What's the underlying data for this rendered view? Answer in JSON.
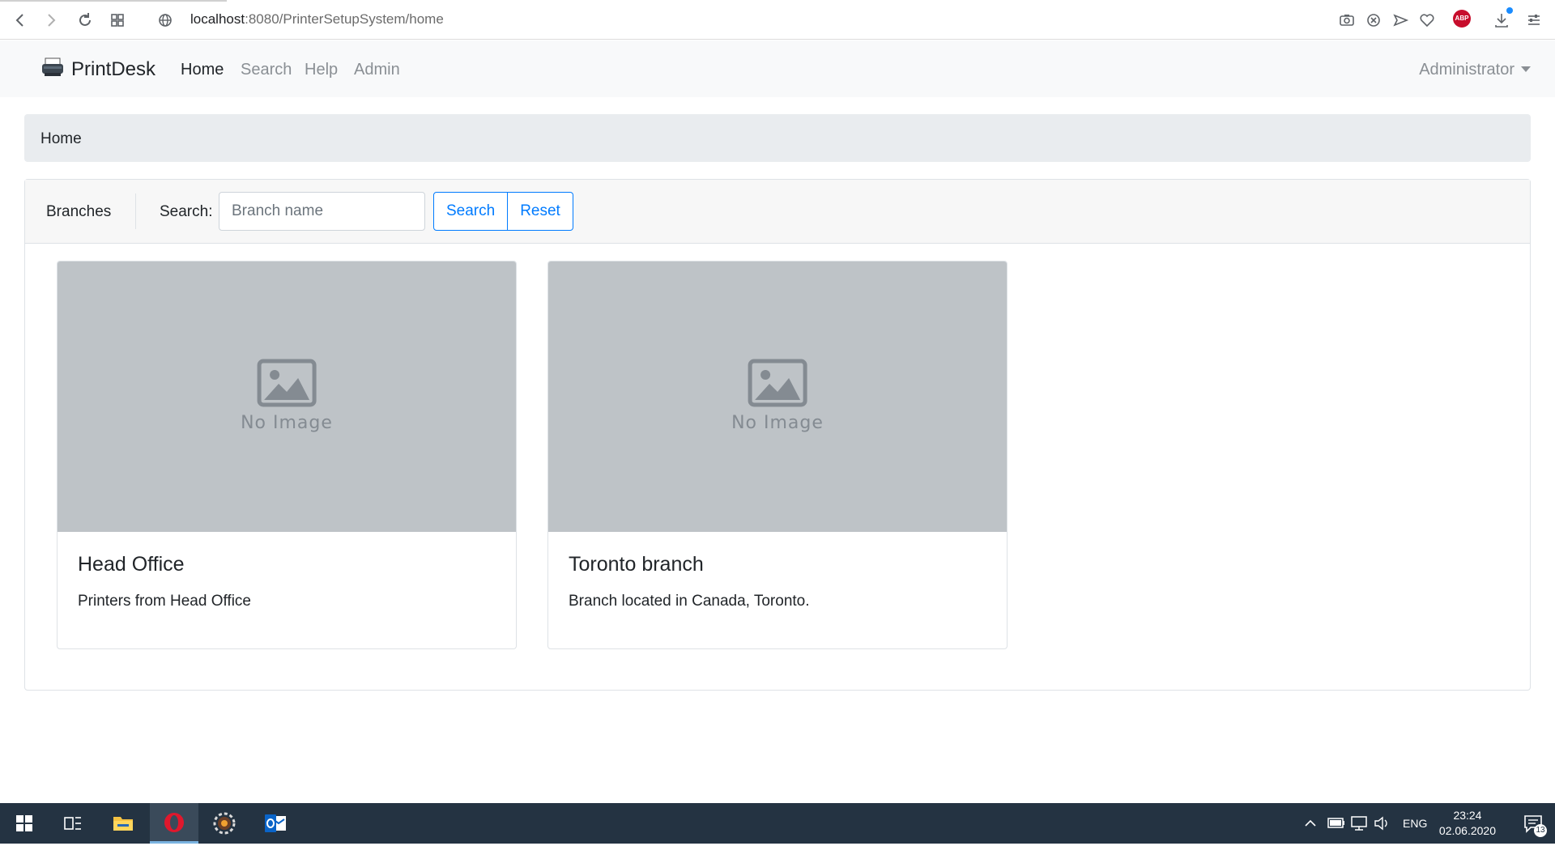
{
  "browser": {
    "url_host": "localhost",
    "url_path": ":8080/PrinterSetupSystem/home",
    "abp_label": "ABP"
  },
  "navbar": {
    "brand": "PrintDesk",
    "links": [
      {
        "label": "Home",
        "active": true
      },
      {
        "label": "Search",
        "active": false
      },
      {
        "label": "Help",
        "active": false
      },
      {
        "label": "Admin",
        "active": false
      }
    ],
    "user_menu": "Administrator"
  },
  "breadcrumb": {
    "current": "Home"
  },
  "branches_panel": {
    "title": "Branches",
    "search_label": "Search:",
    "search_placeholder": "Branch name",
    "search_value": "",
    "search_button": "Search",
    "reset_button": "Reset"
  },
  "branches": [
    {
      "image_text": "No Image",
      "title": "Head Office",
      "description": "Printers from Head Office"
    },
    {
      "image_text": "No Image",
      "title": "Toronto branch",
      "description": "Branch located in Canada, Toronto."
    }
  ],
  "taskbar": {
    "language": "ENG",
    "time": "23:24",
    "date": "02.06.2020",
    "notification_count": "13"
  },
  "colors": {
    "primary": "#007bff",
    "navbar_bg": "#f8f9fa",
    "breadcrumb_bg": "#e9ecef",
    "placeholder_bg": "#bec3c7",
    "taskbar_bg": "#243342"
  }
}
